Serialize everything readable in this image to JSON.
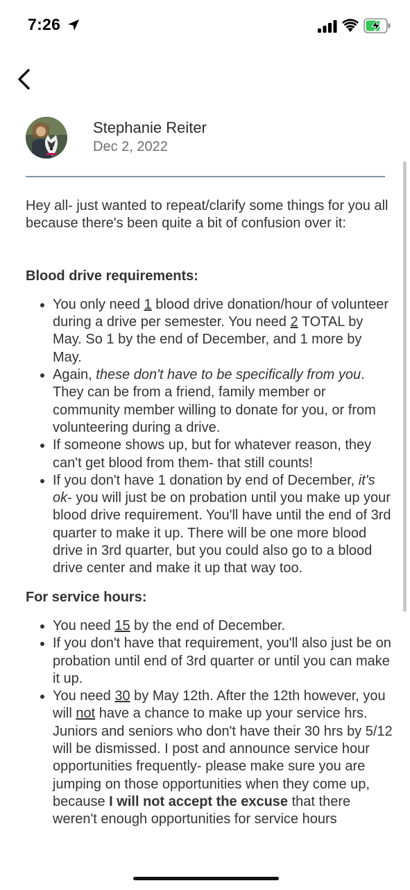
{
  "status_bar": {
    "time": "7:26"
  },
  "post": {
    "author": "Stephanie Reiter",
    "date": "Dec 2, 2022",
    "intro": "Hey all- just wanted to repeat/clarify some things for you all because there's been quite a bit of confusion over it:",
    "blood": {
      "heading": "Blood drive requirements:",
      "b1": {
        "t1": "You only need ",
        "u1": "1",
        "t2": " blood drive donation/hour of volunteer during a drive per semester. You need ",
        "u2": "2",
        "t3": " TOTAL by May. So 1 by the end of December, and 1 more by May."
      },
      "b2": {
        "t1": "Again, ",
        "em": "these don't have to be specifically from you",
        "t2": ". They can be from a friend, family member or community member willing to donate for you, or from volunteering during a drive."
      },
      "b3": {
        "t1": "If someone shows up, but for whatever reason, they can't get blood from them- that still counts!"
      },
      "b4": {
        "t1": "If you don't have 1 donation by end of December, ",
        "em": "it's ok",
        "t2": "- you will just be on probation until you make up your blood drive requirement. You'll have until the end of 3rd quarter to make it up. There will be one more blood drive in 3rd quarter, but you could also go to a blood drive center and make it up that way too."
      }
    },
    "service": {
      "heading": "For service hours:",
      "s1": {
        "t1": "You need ",
        "u1": "15",
        "t2": " by the end of December."
      },
      "s2": {
        "t1": "If you don't have that requirement, you'll also just be on probation until end of 3rd quarter or until you can make it up."
      },
      "s3": {
        "t1": "You need ",
        "u1": "30",
        "t2": " by May 12th. After the 12th however, you will ",
        "u2": "not",
        "t3": " have a chance to make up your service hrs. Juniors and seniors who don't have their 30 hrs by 5/12 will be dismissed. I post and announce service hour opportunities frequently- please make sure you are jumping on those opportunities when they come up, because ",
        "strong": "I will not accept the excuse",
        "t4": " that there weren't enough opportunities for service hours"
      }
    }
  },
  "colors": {
    "divider": "#7f98a5",
    "battery": "#34c759"
  },
  "icons": {
    "back": "chevron-left-icon",
    "location": "location-arrow-icon",
    "signal": "cellular-signal-icon",
    "wifi": "wifi-icon",
    "battery": "battery-charging-icon"
  }
}
